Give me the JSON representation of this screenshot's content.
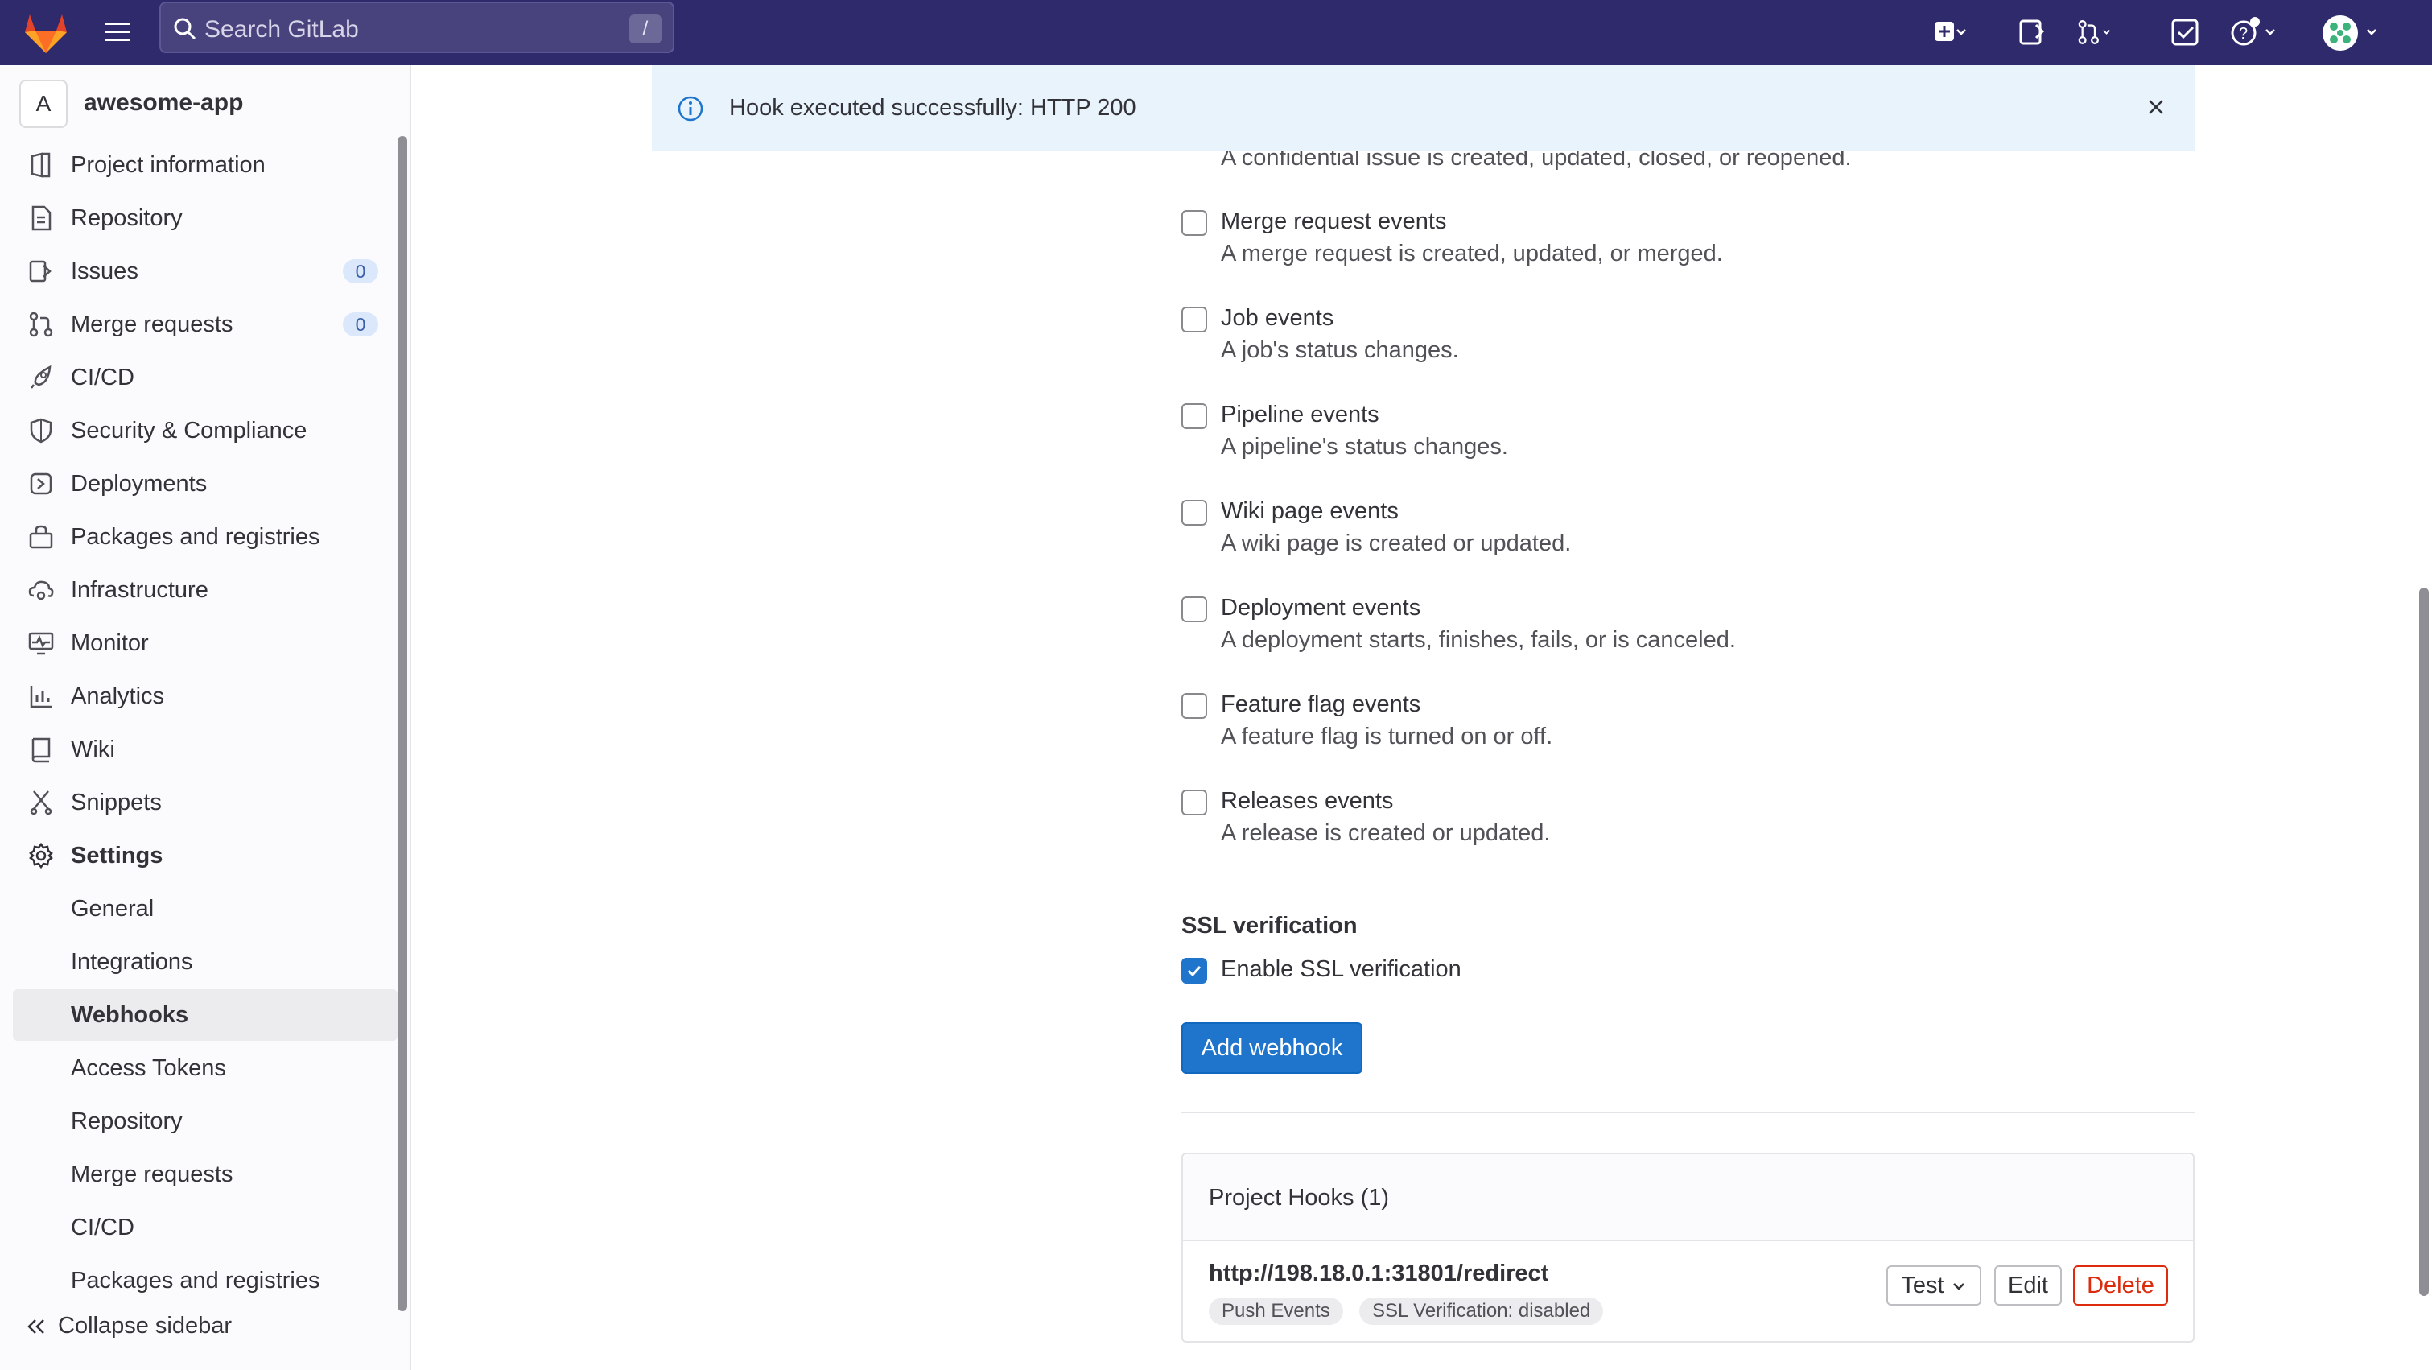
{
  "topbar": {
    "search_placeholder": "Search GitLab",
    "search_shortcut": "/"
  },
  "sidebar": {
    "project_avatar": "A",
    "project_name": "awesome-app",
    "items": [
      {
        "label": "Project information",
        "icon": "project-icon"
      },
      {
        "label": "Repository",
        "icon": "document-icon"
      },
      {
        "label": "Issues",
        "icon": "issues-icon",
        "count": "0"
      },
      {
        "label": "Merge requests",
        "icon": "merge-request-icon",
        "count": "0"
      },
      {
        "label": "CI/CD",
        "icon": "rocket-icon"
      },
      {
        "label": "Security & Compliance",
        "icon": "shield-icon"
      },
      {
        "label": "Deployments",
        "icon": "deployments-icon"
      },
      {
        "label": "Packages and registries",
        "icon": "package-icon"
      },
      {
        "label": "Infrastructure",
        "icon": "cloud-gear-icon"
      },
      {
        "label": "Monitor",
        "icon": "monitor-icon"
      },
      {
        "label": "Analytics",
        "icon": "chart-icon"
      },
      {
        "label": "Wiki",
        "icon": "book-icon"
      },
      {
        "label": "Snippets",
        "icon": "snippet-icon"
      },
      {
        "label": "Settings",
        "icon": "gear-icon"
      }
    ],
    "settings_sub": [
      {
        "label": "General"
      },
      {
        "label": "Integrations"
      },
      {
        "label": "Webhooks"
      },
      {
        "label": "Access Tokens"
      },
      {
        "label": "Repository"
      },
      {
        "label": "Merge requests"
      },
      {
        "label": "CI/CD"
      },
      {
        "label": "Packages and registries"
      }
    ],
    "collapse_label": "Collapse sidebar"
  },
  "alert": {
    "message": "Hook executed successfully: HTTP 200"
  },
  "triggers": {
    "partial_desc": "A confidential issue is created, updated, closed, or reopened.",
    "events": [
      {
        "label": "Merge request events",
        "desc": "A merge request is created, updated, or merged.",
        "checked": false
      },
      {
        "label": "Job events",
        "desc": "A job's status changes.",
        "checked": false
      },
      {
        "label": "Pipeline events",
        "desc": "A pipeline's status changes.",
        "checked": false
      },
      {
        "label": "Wiki page events",
        "desc": "A wiki page is created or updated.",
        "checked": false
      },
      {
        "label": "Deployment events",
        "desc": "A deployment starts, finishes, fails, or is canceled.",
        "checked": false
      },
      {
        "label": "Feature flag events",
        "desc": "A feature flag is turned on or off.",
        "checked": false
      },
      {
        "label": "Releases events",
        "desc": "A release is created or updated.",
        "checked": false
      }
    ]
  },
  "ssl": {
    "title": "SSL verification",
    "label": "Enable SSL verification",
    "checked": true
  },
  "add_button": "Add webhook",
  "hooks": {
    "title": "Project Hooks (1)",
    "url": "http://198.18.0.1:31801/redirect",
    "badges": [
      "Push Events",
      "SSL Verification: disabled"
    ],
    "test_label": "Test",
    "edit_label": "Edit",
    "delete_label": "Delete"
  },
  "colors": {
    "topbar": "#2f2a6b",
    "primary": "#1f75cb",
    "danger": "#dd2b0e",
    "alert_bg": "#e9f3fc"
  }
}
